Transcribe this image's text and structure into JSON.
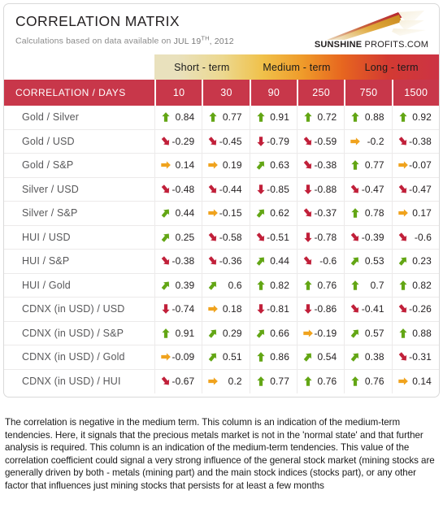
{
  "header": {
    "title": "CORRELATION MATRIX",
    "subtitle_prefix": "Calculations based on data available on",
    "date_month_day": "JUL 19",
    "date_ordinal": "TH",
    "date_year": ", 2012",
    "logo_bold": "SUNSHINE",
    "logo_light": " PROFITS.COM"
  },
  "colors": {
    "brand_red": "#c8374a",
    "positive_green": "#63a615",
    "neutral_orange": "#f0a31e",
    "negative_red": "#c1203a",
    "band_start": "#e9e1bd",
    "band_mid": "#f0c14a",
    "band_end": "#cc3344"
  },
  "terms": [
    {
      "label": "Short - term"
    },
    {
      "label": "Medium - term"
    },
    {
      "label": "Long - term"
    }
  ],
  "table": {
    "corner_label": "CORRELATION / DAYS",
    "columns": [
      "10",
      "30",
      "90",
      "250",
      "750",
      "1500"
    ],
    "rows": [
      {
        "label": "Gold / Silver",
        "cells": [
          {
            "value": "0.84",
            "arrow": "arrow-up",
            "tone": "positive"
          },
          {
            "value": "0.77",
            "arrow": "arrow-up",
            "tone": "positive"
          },
          {
            "value": "0.91",
            "arrow": "arrow-up",
            "tone": "positive"
          },
          {
            "value": "0.72",
            "arrow": "arrow-up",
            "tone": "positive"
          },
          {
            "value": "0.88",
            "arrow": "arrow-up",
            "tone": "positive"
          },
          {
            "value": "0.92",
            "arrow": "arrow-up",
            "tone": "positive"
          }
        ]
      },
      {
        "label": "Gold / USD",
        "cells": [
          {
            "value": "-0.29",
            "arrow": "arrow-down-right",
            "tone": "negative"
          },
          {
            "value": "-0.45",
            "arrow": "arrow-down-right",
            "tone": "negative"
          },
          {
            "value": "-0.79",
            "arrow": "arrow-down",
            "tone": "negative"
          },
          {
            "value": "-0.59",
            "arrow": "arrow-down-right",
            "tone": "negative"
          },
          {
            "value": "-0.2",
            "arrow": "arrow-right",
            "tone": "neutral"
          },
          {
            "value": "-0.38",
            "arrow": "arrow-down-right",
            "tone": "negative"
          }
        ]
      },
      {
        "label": "Gold / S&P",
        "cells": [
          {
            "value": "0.14",
            "arrow": "arrow-right",
            "tone": "neutral"
          },
          {
            "value": "0.19",
            "arrow": "arrow-right",
            "tone": "neutral"
          },
          {
            "value": "0.63",
            "arrow": "arrow-up-right",
            "tone": "positive"
          },
          {
            "value": "-0.38",
            "arrow": "arrow-down-right",
            "tone": "negative"
          },
          {
            "value": "0.77",
            "arrow": "arrow-up",
            "tone": "positive"
          },
          {
            "value": "-0.07",
            "arrow": "arrow-right",
            "tone": "neutral"
          }
        ]
      },
      {
        "label": "Silver / USD",
        "cells": [
          {
            "value": "-0.48",
            "arrow": "arrow-down-right",
            "tone": "negative"
          },
          {
            "value": "-0.44",
            "arrow": "arrow-down-right",
            "tone": "negative"
          },
          {
            "value": "-0.85",
            "arrow": "arrow-down",
            "tone": "negative"
          },
          {
            "value": "-0.88",
            "arrow": "arrow-down",
            "tone": "negative"
          },
          {
            "value": "-0.47",
            "arrow": "arrow-down-right",
            "tone": "negative"
          },
          {
            "value": "-0.47",
            "arrow": "arrow-down-right",
            "tone": "negative"
          }
        ]
      },
      {
        "label": "Silver / S&P",
        "cells": [
          {
            "value": "0.44",
            "arrow": "arrow-up-right",
            "tone": "positive"
          },
          {
            "value": "-0.15",
            "arrow": "arrow-right",
            "tone": "neutral"
          },
          {
            "value": "0.62",
            "arrow": "arrow-up-right",
            "tone": "positive"
          },
          {
            "value": "-0.37",
            "arrow": "arrow-down-right",
            "tone": "negative"
          },
          {
            "value": "0.78",
            "arrow": "arrow-up",
            "tone": "positive"
          },
          {
            "value": "0.17",
            "arrow": "arrow-right",
            "tone": "neutral"
          }
        ]
      },
      {
        "label": "HUI / USD",
        "cells": [
          {
            "value": "0.25",
            "arrow": "arrow-up-right",
            "tone": "positive"
          },
          {
            "value": "-0.58",
            "arrow": "arrow-down-right",
            "tone": "negative"
          },
          {
            "value": "-0.51",
            "arrow": "arrow-down-right",
            "tone": "negative"
          },
          {
            "value": "-0.78",
            "arrow": "arrow-down",
            "tone": "negative"
          },
          {
            "value": "-0.39",
            "arrow": "arrow-down-right",
            "tone": "negative"
          },
          {
            "value": "-0.6",
            "arrow": "arrow-down-right",
            "tone": "negative"
          }
        ]
      },
      {
        "label": "HUI / S&P",
        "cells": [
          {
            "value": "-0.38",
            "arrow": "arrow-down-right",
            "tone": "negative"
          },
          {
            "value": "-0.36",
            "arrow": "arrow-down-right",
            "tone": "negative"
          },
          {
            "value": "0.44",
            "arrow": "arrow-up-right",
            "tone": "positive"
          },
          {
            "value": "-0.6",
            "arrow": "arrow-down-right",
            "tone": "negative"
          },
          {
            "value": "0.53",
            "arrow": "arrow-up-right",
            "tone": "positive"
          },
          {
            "value": "0.23",
            "arrow": "arrow-up-right",
            "tone": "positive"
          }
        ]
      },
      {
        "label": "HUI / Gold",
        "cells": [
          {
            "value": "0.39",
            "arrow": "arrow-up-right",
            "tone": "positive"
          },
          {
            "value": "0.6",
            "arrow": "arrow-up-right",
            "tone": "positive"
          },
          {
            "value": "0.82",
            "arrow": "arrow-up",
            "tone": "positive"
          },
          {
            "value": "0.76",
            "arrow": "arrow-up",
            "tone": "positive"
          },
          {
            "value": "0.7",
            "arrow": "arrow-up",
            "tone": "positive"
          },
          {
            "value": "0.82",
            "arrow": "arrow-up",
            "tone": "positive"
          }
        ]
      },
      {
        "label": "CDNX (in USD) / USD",
        "cells": [
          {
            "value": "-0.74",
            "arrow": "arrow-down",
            "tone": "negative"
          },
          {
            "value": "0.18",
            "arrow": "arrow-right",
            "tone": "neutral"
          },
          {
            "value": "-0.81",
            "arrow": "arrow-down",
            "tone": "negative"
          },
          {
            "value": "-0.86",
            "arrow": "arrow-down",
            "tone": "negative"
          },
          {
            "value": "-0.41",
            "arrow": "arrow-down-right",
            "tone": "negative"
          },
          {
            "value": "-0.26",
            "arrow": "arrow-down-right",
            "tone": "negative"
          }
        ]
      },
      {
        "label": "CDNX (in USD) / S&P",
        "cells": [
          {
            "value": "0.91",
            "arrow": "arrow-up",
            "tone": "positive"
          },
          {
            "value": "0.29",
            "arrow": "arrow-up-right",
            "tone": "positive"
          },
          {
            "value": "0.66",
            "arrow": "arrow-up-right",
            "tone": "positive"
          },
          {
            "value": "-0.19",
            "arrow": "arrow-right",
            "tone": "neutral"
          },
          {
            "value": "0.57",
            "arrow": "arrow-up-right",
            "tone": "positive"
          },
          {
            "value": "0.88",
            "arrow": "arrow-up",
            "tone": "positive"
          }
        ]
      },
      {
        "label": "CDNX (in USD) / Gold",
        "cells": [
          {
            "value": "-0.09",
            "arrow": "arrow-right",
            "tone": "neutral"
          },
          {
            "value": "0.51",
            "arrow": "arrow-up-right",
            "tone": "positive"
          },
          {
            "value": "0.86",
            "arrow": "arrow-up",
            "tone": "positive"
          },
          {
            "value": "0.54",
            "arrow": "arrow-up-right",
            "tone": "positive"
          },
          {
            "value": "0.38",
            "arrow": "arrow-up-right",
            "tone": "positive"
          },
          {
            "value": "-0.31",
            "arrow": "arrow-down-right",
            "tone": "negative"
          }
        ]
      },
      {
        "label": "CDNX (in USD) / HUI",
        "cells": [
          {
            "value": "-0.67",
            "arrow": "arrow-down-right",
            "tone": "negative"
          },
          {
            "value": "0.2",
            "arrow": "arrow-right",
            "tone": "neutral"
          },
          {
            "value": "0.77",
            "arrow": "arrow-up",
            "tone": "positive"
          },
          {
            "value": "0.76",
            "arrow": "arrow-up",
            "tone": "positive"
          },
          {
            "value": "0.76",
            "arrow": "arrow-up",
            "tone": "positive"
          },
          {
            "value": "0.14",
            "arrow": "arrow-right",
            "tone": "neutral"
          }
        ]
      }
    ]
  },
  "note": {
    "text": "The correlation is negative in the medium term. This column is an indication of the medium-term tendencies. Here, it signals that the precious metals market is not in the 'normal state' and that further analysis is required. This column is an indication of the medium-term tendencies. This value of the correlation coefficient could signal a very strong influence of the general stock market (mining stocks are generally driven by both - metals (mining part) and the main stock indices (stocks part), or any other factor that influences just mining stocks that persists for at least a few months"
  }
}
